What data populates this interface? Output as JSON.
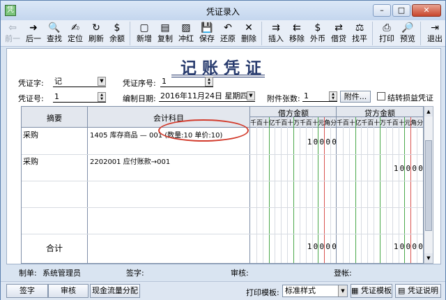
{
  "window": {
    "title": "凭证录入",
    "icon_text": "凭",
    "min": "–",
    "max": "□",
    "close": "✕"
  },
  "toolbar": [
    {
      "name": "prev",
      "label": "前一",
      "icon": "⇦",
      "disabled": true
    },
    {
      "name": "next",
      "label": "后一",
      "icon": "➜"
    },
    {
      "name": "find",
      "label": "查找",
      "icon": "🔍"
    },
    {
      "name": "locate",
      "label": "定位",
      "icon": "✍"
    },
    {
      "name": "refresh",
      "label": "刷新",
      "icon": "↻"
    },
    {
      "name": "balance",
      "label": "余额",
      "icon": "$"
    },
    {
      "name": "sep"
    },
    {
      "name": "new",
      "label": "新增",
      "icon": "▢"
    },
    {
      "name": "copy",
      "label": "复制",
      "icon": "▤"
    },
    {
      "name": "reverse",
      "label": "冲红",
      "icon": "▨"
    },
    {
      "name": "save",
      "label": "保存",
      "icon": "💾"
    },
    {
      "name": "restore",
      "label": "还原",
      "icon": "↶"
    },
    {
      "name": "delete",
      "label": "删除",
      "icon": "✕"
    },
    {
      "name": "sep"
    },
    {
      "name": "insert",
      "label": "插入",
      "icon": "⇉"
    },
    {
      "name": "remove",
      "label": "移除",
      "icon": "⇇"
    },
    {
      "name": "forex",
      "label": "外币",
      "icon": "$"
    },
    {
      "name": "debit",
      "label": "借贷",
      "icon": "⇄"
    },
    {
      "name": "balance-out",
      "label": "找平",
      "icon": "⚖"
    },
    {
      "name": "sep"
    },
    {
      "name": "print",
      "label": "打印",
      "icon": "⎙"
    },
    {
      "name": "preview",
      "label": "预览",
      "icon": "🔎"
    },
    {
      "name": "sep"
    },
    {
      "name": "exit",
      "label": "退出",
      "icon": "⇥"
    }
  ],
  "voucher": {
    "title": "记账凭证",
    "voucher_type_label": "凭证字:",
    "voucher_type_value": "记",
    "voucher_seq_label": "凭证序号:",
    "voucher_seq_value": "1",
    "voucher_no_label": "凭证号:",
    "voucher_no_value": "1",
    "date_label": "编制日期:",
    "date_value": "2016年11月24日 星期四",
    "attachments_label": "附件张数:",
    "attachments_value": "1",
    "attach_button": "附件...",
    "transfer_checkbox_label": "结转损益凭证"
  },
  "table": {
    "col_summary": "摘要",
    "col_account": "会计科目",
    "col_debit": "借方金额",
    "col_credit": "贷方金额",
    "digit_headers": [
      "千",
      "百",
      "十",
      "亿",
      "千",
      "百",
      "十",
      "万",
      "千",
      "百",
      "十",
      "元",
      "角",
      "分"
    ],
    "rows": [
      {
        "summary": "采购",
        "account": "1405  库存商品 — 001 (数量:10 单价:10)",
        "debit": "10000",
        "credit": ""
      },
      {
        "summary": "采购",
        "account": "2202001  应付账款→001",
        "debit": "",
        "credit": "10000"
      },
      {
        "summary": "",
        "account": "",
        "debit": "",
        "credit": ""
      },
      {
        "summary": "",
        "account": "",
        "debit": "",
        "credit": ""
      }
    ],
    "total_label": "合计",
    "total_debit": "10000",
    "total_credit": "10000"
  },
  "footer": {
    "maker_label": "制单:",
    "maker_value": "系统管理员",
    "sign_label": "签字:",
    "audit_label": "审核:",
    "post_label": "登帐:"
  },
  "bottom": {
    "sign_button": "签字",
    "audit_button": "审核",
    "cashflow_button": "现金流量分配",
    "print_template_label": "打印模板:",
    "print_template_value": "标准样式",
    "template_button": "凭证模板",
    "guide_button": "凭证说明"
  },
  "colors": {
    "red_line": "#d9534f",
    "green_line": "#4aa84a",
    "annotation_oval": "#d23b2c",
    "title": "#283b6e"
  }
}
